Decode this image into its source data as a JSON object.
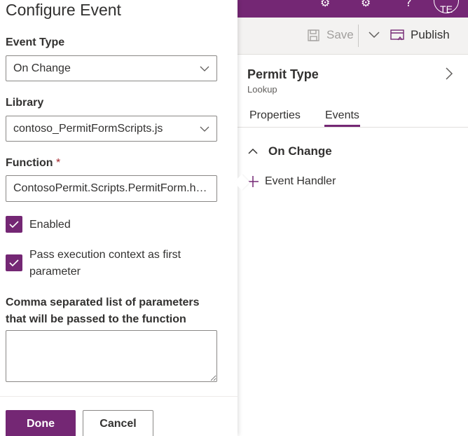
{
  "app": {
    "avatar_initials": "TE",
    "brand_color": "#742774"
  },
  "topbar": {
    "icons": [
      "gear-icon",
      "settings-gear-icon",
      "help-icon"
    ]
  },
  "command_bar": {
    "save_label": "Save",
    "publish_label": "Publish"
  },
  "properties_pane": {
    "title": "Permit Type",
    "subtitle": "Lookup",
    "tabs": [
      {
        "label": "Properties",
        "active": false
      },
      {
        "label": "Events",
        "active": true
      }
    ],
    "section_title": "On Change",
    "add_handler_label": "Event Handler"
  },
  "configure_event": {
    "title": "Configure Event",
    "event_type": {
      "label": "Event Type",
      "value": "On Change"
    },
    "library": {
      "label": "Library",
      "value": "contoso_PermitFormScripts.js"
    },
    "function": {
      "label": "Function",
      "required_marker": "*",
      "value": "ContosoPermit.Scripts.PermitForm.handleOnChangePermitType"
    },
    "enabled": {
      "label": "Enabled",
      "checked": true
    },
    "pass_context": {
      "label": "Pass execution context as first parameter",
      "checked": true
    },
    "parameters": {
      "label": "Comma separated list of parameters that will be passed to the function",
      "value": ""
    },
    "done_label": "Done",
    "cancel_label": "Cancel"
  }
}
